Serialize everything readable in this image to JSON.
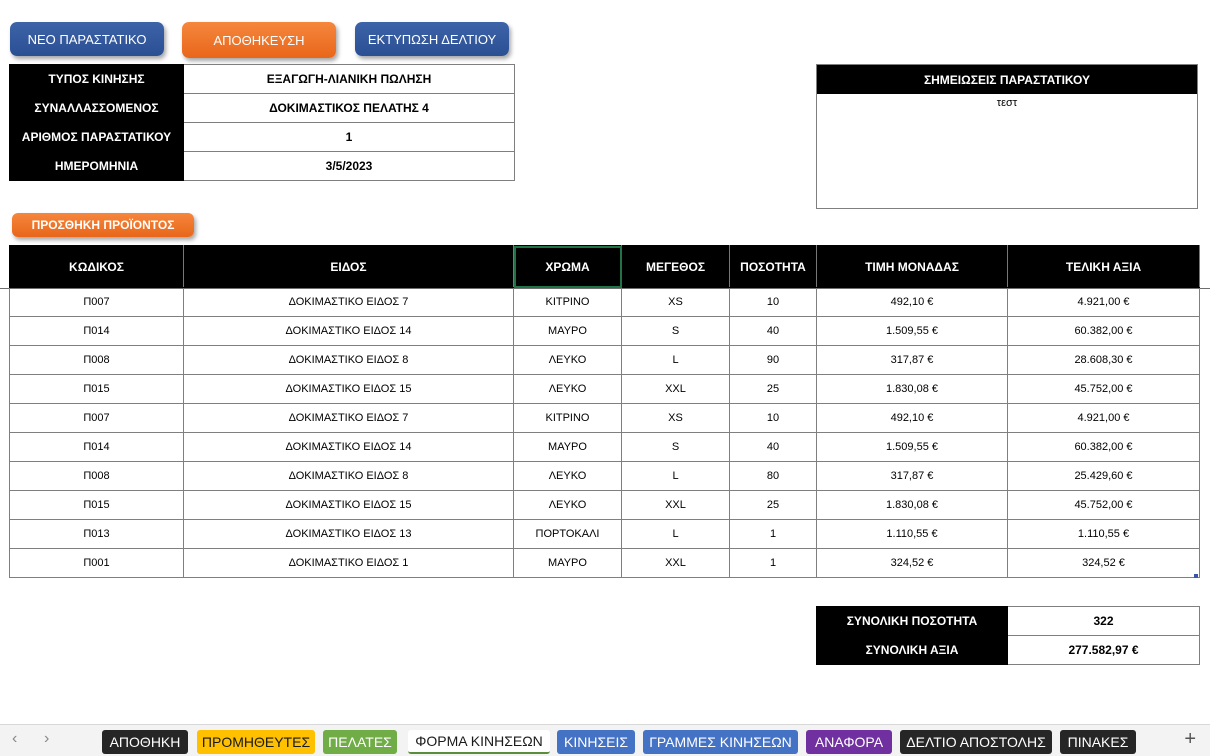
{
  "buttons": {
    "new_doc": "ΝΕΟ ΠΑΡΑΣΤΑΤΙΚΟ",
    "save": "ΑΠΟΘΗΚΕΥΣΗ",
    "print": "ΕΚΤΥΠΩΣΗ ΔΕΛΤΙΟΥ",
    "add_product": "ΠΡΟΣΘΗΚΗ ΠΡΟΪΟΝΤΟΣ"
  },
  "info": {
    "rows": [
      {
        "label": "ΤΥΠΟΣ ΚΙΝΗΣΗΣ",
        "value": "ΕΞΑΓΩΓΗ-ΛΙΑΝΙΚΗ ΠΩΛΗΣΗ"
      },
      {
        "label": "ΣΥΝΑΛΛΑΣΣΟΜΕΝΟΣ",
        "value": "ΔΟΚΙΜΑΣΤΙΚΟΣ ΠΕΛΑΤΗΣ 4"
      },
      {
        "label": "ΑΡΙΘΜΟΣ ΠΑΡΑΣΤΑΤΙΚΟΥ",
        "value": "1"
      },
      {
        "label": "ΗΜΕΡΟΜΗΝΙΑ",
        "value": "3/5/2023"
      }
    ]
  },
  "notes": {
    "title": "ΣΗΜΕΙΩΣΕΙΣ ΠΑΡΑΣΤΑΤΙΚΟΥ",
    "text": "τεστ"
  },
  "items": {
    "columns": [
      "ΚΩΔΙΚΟΣ",
      "ΕΙΔΟΣ",
      "ΧΡΩΜΑ",
      "ΜΕΓΕΘΟΣ",
      "ΠΟΣΟΤΗΤΑ",
      "ΤΙΜΗ ΜΟΝΑΔΑΣ",
      "ΤΕΛΙΚΗ ΑΞΙΑ"
    ],
    "rows": [
      [
        "Π007",
        "ΔΟΚΙΜΑΣΤΙΚΟ ΕΙΔΟΣ 7",
        "ΚΙΤΡΙΝΟ",
        "XS",
        "10",
        "492,10 €",
        "4.921,00 €"
      ],
      [
        "Π014",
        "ΔΟΚΙΜΑΣΤΙΚΟ ΕΙΔΟΣ 14",
        "ΜΑΥΡΟ",
        "S",
        "40",
        "1.509,55 €",
        "60.382,00 €"
      ],
      [
        "Π008",
        "ΔΟΚΙΜΑΣΤΙΚΟ ΕΙΔΟΣ 8",
        "ΛΕΥΚΟ",
        "L",
        "90",
        "317,87 €",
        "28.608,30 €"
      ],
      [
        "Π015",
        "ΔΟΚΙΜΑΣΤΙΚΟ ΕΙΔΟΣ 15",
        "ΛΕΥΚΟ",
        "XXL",
        "25",
        "1.830,08 €",
        "45.752,00 €"
      ],
      [
        "Π007",
        "ΔΟΚΙΜΑΣΤΙΚΟ ΕΙΔΟΣ 7",
        "ΚΙΤΡΙΝΟ",
        "XS",
        "10",
        "492,10 €",
        "4.921,00 €"
      ],
      [
        "Π014",
        "ΔΟΚΙΜΑΣΤΙΚΟ ΕΙΔΟΣ 14",
        "ΜΑΥΡΟ",
        "S",
        "40",
        "1.509,55 €",
        "60.382,00 €"
      ],
      [
        "Π008",
        "ΔΟΚΙΜΑΣΤΙΚΟ ΕΙΔΟΣ 8",
        "ΛΕΥΚΟ",
        "L",
        "80",
        "317,87 €",
        "25.429,60 €"
      ],
      [
        "Π015",
        "ΔΟΚΙΜΑΣΤΙΚΟ ΕΙΔΟΣ 15",
        "ΛΕΥΚΟ",
        "XXL",
        "25",
        "1.830,08 €",
        "45.752,00 €"
      ],
      [
        "Π013",
        "ΔΟΚΙΜΑΣΤΙΚΟ ΕΙΔΟΣ 13",
        "ΠΟΡΤΟΚΑΛΙ",
        "L",
        "1",
        "1.110,55 €",
        "1.110,55 €"
      ],
      [
        "Π001",
        "ΔΟΚΙΜΑΣΤΙΚΟ ΕΙΔΟΣ 1",
        "ΜΑΥΡΟ",
        "XXL",
        "1",
        "324,52 €",
        "324,52 €"
      ]
    ]
  },
  "totals": {
    "qty_label": "ΣΥΝΟΛΙΚΗ ΠΟΣΟΤΗΤΑ",
    "qty_value": "322",
    "value_label": "ΣΥΝΟΛΙΚΗ ΑΞΙΑ",
    "value_value": "277.582,97 €"
  },
  "sheet_tabs": [
    {
      "label": "ΑΠΟΘΗΚΗ",
      "color": "#262626"
    },
    {
      "label": "ΠΡΟΜΗΘΕΥΤΕΣ",
      "color": "#ffc000"
    },
    {
      "label": "ΠΕΛΑΤΕΣ",
      "color": "#70ad47"
    },
    {
      "label": "ΦΟΡΜΑ ΚΙΝΗΣΕΩΝ",
      "color": "#ffffff",
      "active": true
    },
    {
      "label": "ΚΙΝΗΣΕΙΣ",
      "color": "#4472c4"
    },
    {
      "label": "ΓΡΑΜΜΕΣ ΚΙΝΗΣΕΩΝ",
      "color": "#4472c4"
    },
    {
      "label": "ΑΝΑΦΟΡΑ",
      "color": "#7030a0"
    },
    {
      "label": "ΔΕΛΤΙΟ ΑΠΟΣΤΟΛΗΣ",
      "color": "#262626"
    },
    {
      "label": "ΠΙΝΑΚΕΣ",
      "color": "#262626"
    }
  ],
  "icons": {
    "prev": "chevron-left-icon",
    "next": "chevron-right-icon",
    "add_sheet": "plus-icon"
  }
}
